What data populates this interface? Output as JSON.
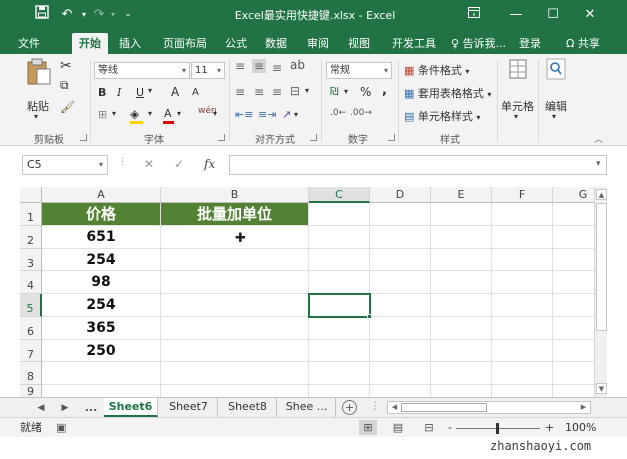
{
  "window": {
    "title": "Excel最实用快捷键.xlsx - Excel",
    "save_icon": "save-icon",
    "undo_icon": "undo-icon",
    "redo_icon": "redo-icon"
  },
  "ribbon_tabs": [
    {
      "label": "文件",
      "active": false
    },
    {
      "label": "开始",
      "active": true
    },
    {
      "label": "插入",
      "active": false
    },
    {
      "label": "页面布局",
      "active": false
    },
    {
      "label": "公式",
      "active": false
    },
    {
      "label": "数据",
      "active": false
    },
    {
      "label": "审阅",
      "active": false
    },
    {
      "label": "视图",
      "active": false
    },
    {
      "label": "开发工具",
      "active": false
    }
  ],
  "tell_me": "告诉我...",
  "sign_in": "登录",
  "share": "共享",
  "ribbon": {
    "clipboard": {
      "paste": "粘贴",
      "label": "剪贴板"
    },
    "font": {
      "name": "等线",
      "size": "11",
      "label": "字体",
      "bold": "B",
      "italic": "I",
      "underline": "U",
      "grow": "A",
      "shrink": "A",
      "color_a": "A",
      "phonetic": "wén"
    },
    "alignment": {
      "label": "对齐方式"
    },
    "number": {
      "format": "常规",
      "percent": "%",
      "comma": ",",
      "label": "数字"
    },
    "styles": {
      "conditional": "条件格式",
      "table": "套用表格格式",
      "cell_styles": "单元格样式",
      "label": "样式"
    },
    "cells": {
      "label": "单元格"
    },
    "editing": {
      "label": "编辑"
    }
  },
  "formula_bar": {
    "name_box": "C5",
    "formula": "",
    "fx": "fx"
  },
  "columns": [
    "A",
    "B",
    "C",
    "D",
    "E",
    "F",
    "G"
  ],
  "selected_column": "C",
  "rows": [
    "1",
    "2",
    "3",
    "4",
    "5",
    "6",
    "7",
    "8",
    "9"
  ],
  "selected_row": "5",
  "table": {
    "header": [
      "价格",
      "批量加单位"
    ],
    "values": [
      "651",
      "254",
      "98",
      "254",
      "365",
      "250"
    ]
  },
  "sheets": [
    {
      "label": "Sheet6",
      "active": true
    },
    {
      "label": "Sheet7",
      "active": false
    },
    {
      "label": "Sheet8",
      "active": false
    },
    {
      "label": "Shee ...",
      "active": false
    }
  ],
  "sheet_nav_more": "...",
  "status": {
    "ready": "就绪",
    "zoom": "100%",
    "zoom_minus": "-",
    "zoom_plus": "+"
  },
  "watermark": "zhanshaoyi.com",
  "colors": {
    "accent": "#217346",
    "table_header": "#548235"
  }
}
